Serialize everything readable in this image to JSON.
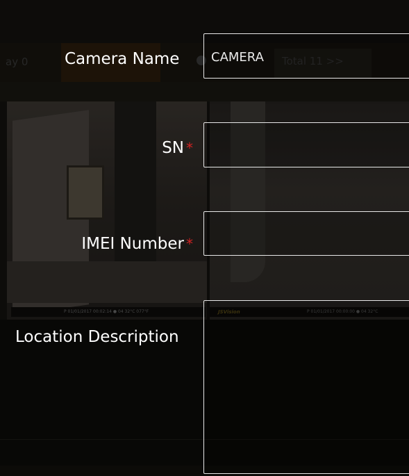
{
  "background": {
    "tab_today_label": "ay 0",
    "total_label": "Total 11 >>",
    "thumb1_osd": "P 01/01/2017 00:02:14 ● 04 32°C 077°F",
    "thumb2_logo": "JSVision",
    "thumb2_osd": "P 01/01/2017 00:00:00 ● 04 32°C"
  },
  "form": {
    "camera_name": {
      "label": "Camera Name",
      "value": "CAMERA"
    },
    "sn": {
      "label": "SN",
      "required_marker": "*",
      "value": ""
    },
    "imei": {
      "label": "IMEI Number",
      "required_marker": "*",
      "value": ""
    },
    "location": {
      "label": "Location Description",
      "value": ""
    }
  },
  "colors": {
    "required": "#d02222",
    "field_border": "#e8e8e8",
    "background": "#0c0b08"
  }
}
